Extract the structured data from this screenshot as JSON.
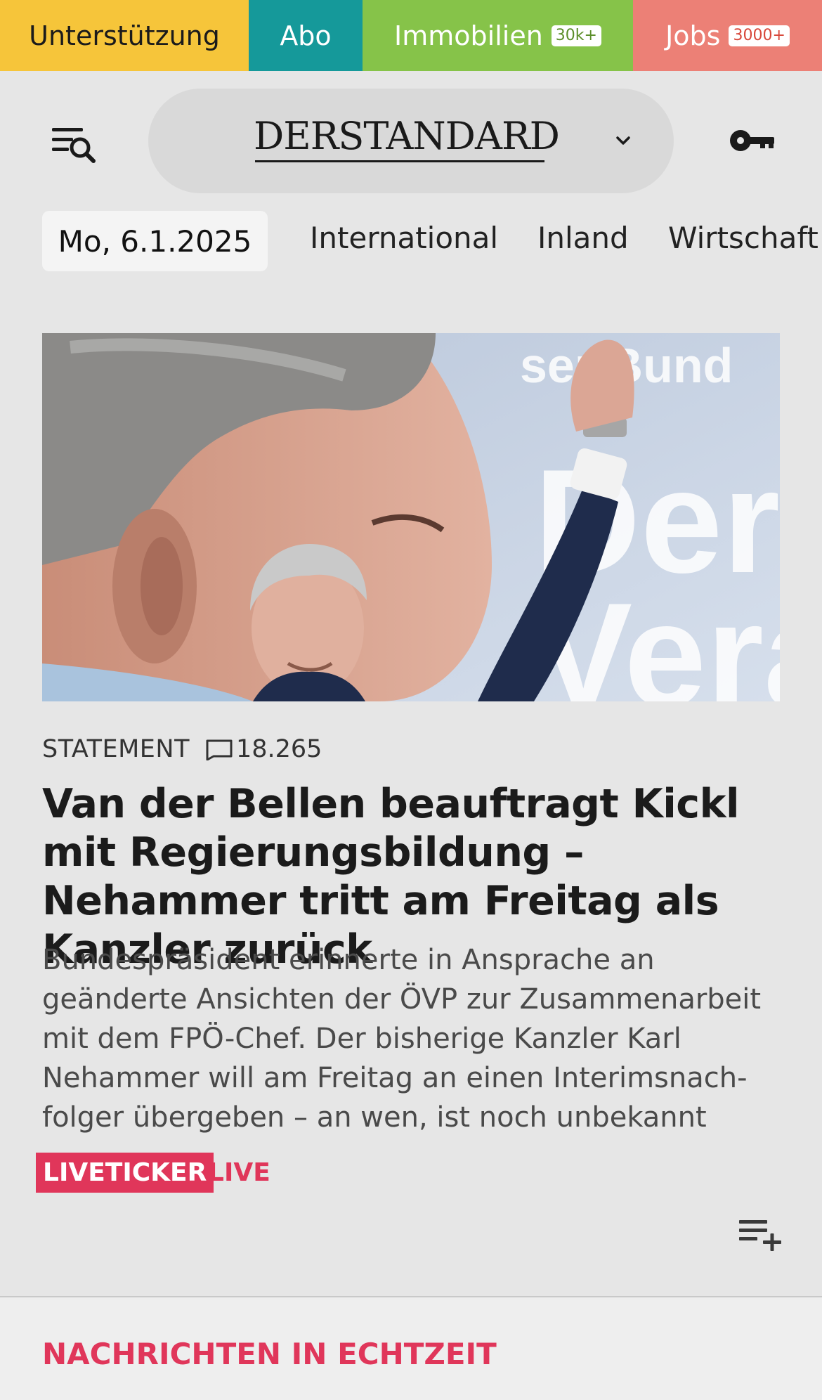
{
  "topbar": {
    "support": "Unterstützung",
    "abo": "Abo",
    "immobilien": "Immobilien",
    "immobilien_badge": "30k+",
    "jobs": "Jobs",
    "jobs_badge": "3000+"
  },
  "header": {
    "logo": "DERSTANDARD",
    "menu_icon": "menu-search-icon",
    "login_icon": "key-icon",
    "dropdown_icon": "chevron-down-icon"
  },
  "nav": {
    "date": "Mo, 6.1.2025",
    "items": [
      "International",
      "Inland",
      "Wirtschaft"
    ]
  },
  "article": {
    "category": "STATEMENT",
    "comment_count": "18.265",
    "headline": "Van der Bellen beauftragt Kickl mit Regierungsbildung – Nehammer tritt am Freitag als Kanzler zurück",
    "teaser": "Bundespräsident erinnerte in Ansprache an geänderte Ansichten der ÖVP zur Zusammenarbeit mit dem FPÖ-Chef. Der bisherige Kanzler Karl Nehammer will am Freitag an einen Interimsnach-folger übergeben – an wen, ist noch unbekannt",
    "live_badge": "LIVETICKER",
    "live_label": "LIVE",
    "hero_backdrop_text": "Unser Bund Der Vera"
  },
  "section": {
    "title": "NACHRICHTEN IN ECHTZEIT"
  },
  "colors": {
    "support_bg": "#f6c53a",
    "abo_bg": "#15999a",
    "immobilien_bg": "#86c349",
    "jobs_bg": "#ec8076",
    "accent_live": "#e0365a",
    "page_bg": "#e6e6e6"
  }
}
